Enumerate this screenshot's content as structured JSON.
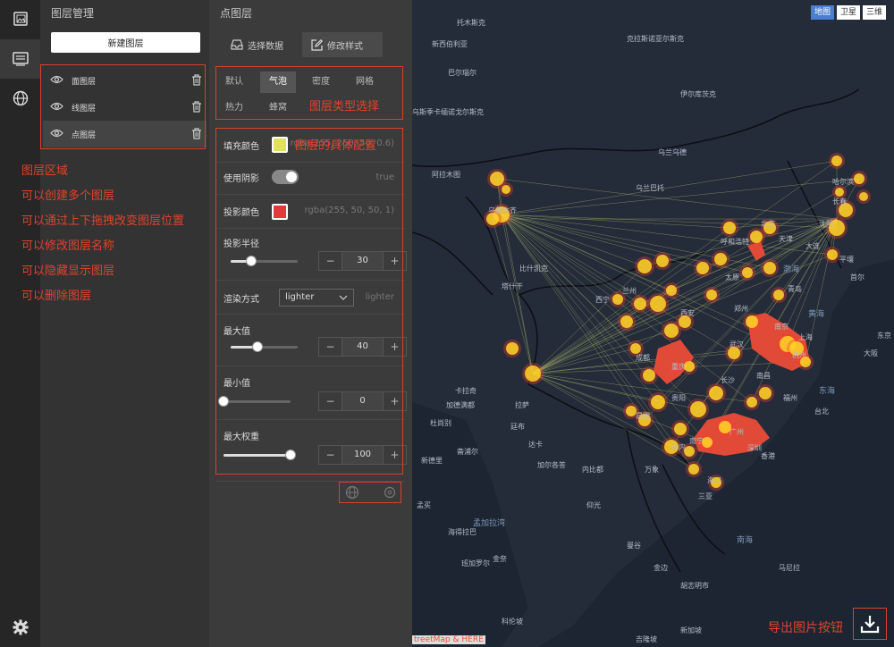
{
  "layer_panel": {
    "title": "图层管理",
    "new_layer_button": "新建图层",
    "layers": [
      {
        "name": "面图层"
      },
      {
        "name": "线图层"
      },
      {
        "name": "点图层"
      }
    ]
  },
  "annotations": {
    "layer_area": [
      "图层区域",
      "可以创建多个图层",
      "可以通过上下拖拽改变图层位置",
      "可以修改图层名称",
      "可以隐藏显示图层",
      "可以删除图层"
    ],
    "layer_type": "图层类型选择",
    "layer_config": "图层的具体配置",
    "export": "导出图片按钮"
  },
  "style_panel": {
    "title": "点图层",
    "tabs": [
      "选择数据",
      "修改样式"
    ],
    "active_tab": "修改样式",
    "type_tabs": [
      "默认",
      "气泡",
      "密度",
      "网格",
      "热力",
      "蜂窝"
    ],
    "active_type": "气泡",
    "fill_color": {
      "label": "填充颜色",
      "value": "rgba(255, 250, 50, 0.6)",
      "swatch": "#e0e25a"
    },
    "shadow": {
      "label": "使用阴影",
      "value": "true"
    },
    "shadow_color": {
      "label": "投影颜色",
      "value": "rgba(255, 50, 50, 1)",
      "swatch": "#e03a3a"
    },
    "shadow_radius": {
      "label": "投影半径",
      "value": 30,
      "value_text": "30",
      "fraction": 0.3
    },
    "blend": {
      "label": "渲染方式",
      "selected": "lighter",
      "value": "lighter"
    },
    "max_value": {
      "label": "最大值",
      "value": 40,
      "value_text": "40",
      "fraction": 0.4
    },
    "min_value": {
      "label": "最小值",
      "value": 0,
      "value_text": "0",
      "fraction": 0.0
    },
    "max_weight": {
      "label": "最大权重",
      "value": 100,
      "value_text": "100",
      "fraction": 1.0
    },
    "stepper_minus": "−",
    "stepper_plus": "+"
  },
  "map": {
    "modes": [
      "地图",
      "卫星",
      "三维"
    ],
    "active_mode": "地图",
    "attribution": "treetMap & HERE",
    "place_labels": [
      "托木斯克",
      "克拉斯诺亚尔斯克",
      "新西伯利亚",
      "巴尔瑙尔",
      "伊尔库茨克",
      "乌兰乌德",
      "乌兰巴托",
      "乌斯季卡缅诺戈尔斯克",
      "阿拉木图",
      "比什凯克",
      "塔什干",
      "杜尚别",
      "卡拉奇",
      "加德满都",
      "新德里",
      "斋浦尔",
      "拉萨",
      "廷布",
      "达卡",
      "加尔各答",
      "孟买",
      "海得拉巴",
      "班加罗尔",
      "金奈",
      "科伦坡",
      "仰光",
      "曼谷",
      "内比都",
      "万象",
      "河内",
      "胡志明市",
      "金边",
      "吉隆坡",
      "新加坡",
      "马尼拉",
      "台北",
      "首尔",
      "平壤",
      "东京",
      "大阪",
      "哈尔滨",
      "长春",
      "沈阳",
      "大连",
      "北京",
      "天津",
      "青岛",
      "上海",
      "杭州",
      "南京",
      "武汉",
      "重庆",
      "成都",
      "西安",
      "兰州",
      "西宁",
      "乌鲁木齐",
      "呼和浩特",
      "太原",
      "郑州",
      "长沙",
      "南昌",
      "福州",
      "广州",
      "深圳",
      "香港",
      "南宁",
      "贵阳",
      "昆明",
      "海口",
      "三亚"
    ],
    "sea_labels": [
      "渤海",
      "黄海",
      "东海",
      "南海",
      "孟加拉湾"
    ]
  }
}
